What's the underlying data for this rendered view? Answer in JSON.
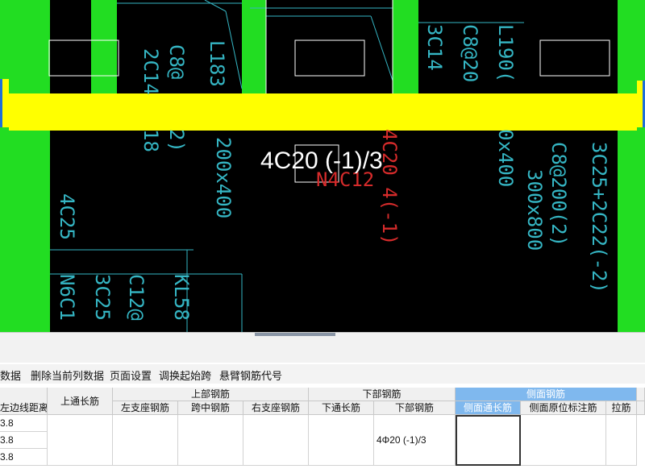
{
  "colors": {
    "canvas_bg": "#000000",
    "column_green": "#22dd22",
    "beam_yellow": "#ffff00",
    "cad_cyan": "#35b6c4",
    "annotation_red": "#d62b2b",
    "selected_header": "#7fb8ee"
  },
  "canvas": {
    "main_label": "4C20 (-1)/3",
    "cyan_labels": {
      "l183": "L183",
      "c8_left": "C8@",
      "twoc14": "2C14",
      "twoc14b": "18",
      "dim_200x400": "200x400",
      "two_b": "2)",
      "fourc25": "4C25",
      "kl58": "KL58",
      "c12": "C12@",
      "threec25_l": "3C25",
      "n6c1": "N6C1",
      "l190": "L190(",
      "c8_mid": "C8@20",
      "threec14": "3C14",
      "dim_x400": "0x400",
      "c8_200": "C8@200(2)",
      "dim_300x800": "300x800",
      "right_rebar": "3C25+2C22(-2)"
    },
    "red_labels": {
      "r1": "4C20 4(-1)",
      "r2": "N4C12"
    }
  },
  "toolbar": {
    "items": [
      "数据",
      "删除当前列数据",
      "页面设置",
      "调换起始跨",
      "悬臂钢筋代号"
    ]
  },
  "grid": {
    "group_headers": {
      "top": "上部钢筋",
      "bottom": "下部钢筋",
      "side": "侧面钢筋"
    },
    "columns": {
      "left_dist": "左边线距离",
      "top_through": "上通长筋",
      "left_support": "左支座钢筋",
      "mid_span": "跨中钢筋",
      "right_support": "右支座钢筋",
      "bottom_through": "下通长筋",
      "bottom_rebar": "下部钢筋",
      "side_through": "侧面通长筋",
      "side_mark": "侧面原位标注筋",
      "tie": "拉筋"
    },
    "rows": [
      {
        "left_dist": "3.8",
        "bottom_rebar": "4Φ20 (-1)/3"
      },
      {
        "left_dist": "3.8"
      },
      {
        "left_dist": "3.8"
      }
    ]
  }
}
